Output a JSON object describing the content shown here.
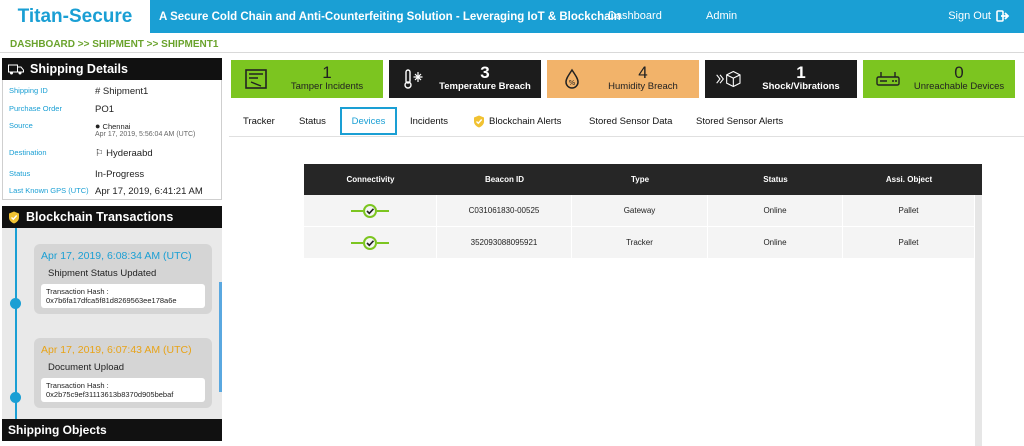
{
  "app": {
    "brand": "Titan-Secure",
    "tagline": "A Secure Cold Chain and Anti-Counterfeiting Solution - Leveraging IoT & Blockchain",
    "nav": [
      "Dashboard",
      "Admin"
    ],
    "signout": "Sign Out"
  },
  "breadcrumb": "DASHBOARD >> SHIPMENT >> SHIPMENT1",
  "shipping": {
    "title": "Shipping Details",
    "fields": [
      {
        "key": "Shipping ID",
        "value": "# Shipment1"
      },
      {
        "key": "Purchase Order",
        "value": "PO1"
      },
      {
        "key": "Source",
        "value": "Chennai",
        "sub": "Apr 17, 2019, 5:56:04 AM (UTC)"
      },
      {
        "key": "Destination",
        "value": "Hyderaabd"
      },
      {
        "key": "Status",
        "value": "In-Progress"
      },
      {
        "key": "Last Known GPS (UTC)",
        "value": "Apr 17, 2019, 6:41:21 AM"
      }
    ]
  },
  "blockchain": {
    "title": "Blockchain Transactions",
    "items": [
      {
        "time": "Apr 17, 2019, 6:08:34 AM (UTC)",
        "event": "Shipment Status Updated",
        "hash_label": "Transaction Hash :",
        "hash": "0x7b6fa17dfca5f81d8269563ee178a6e"
      },
      {
        "time": "Apr 17, 2019, 6:07:43 AM (UTC)",
        "event": "Document Upload",
        "hash_label": "Transaction Hash :",
        "hash": "0x2b75c9ef31113613b8370d905bebaf"
      }
    ],
    "time_colors": [
      "#1a9fd4",
      "#e8a317"
    ]
  },
  "objects": {
    "title": "Shipping Objects"
  },
  "stats": [
    {
      "count": "1",
      "label": "Tamper Incidents",
      "color": "#7cc520",
      "icon": "tamper-icon"
    },
    {
      "count": "3",
      "label": "Temperature Breach",
      "color": "#1c1c1c",
      "icon": "snowflake-thermometer-icon"
    },
    {
      "count": "4",
      "label": "Humidity Breach",
      "color": "#f2b36a",
      "icon": "humidity-drop-icon"
    },
    {
      "count": "1",
      "label": "Shock/Vibrations",
      "color": "#1c1c1c",
      "icon": "shock-box-icon"
    },
    {
      "count": "0",
      "label": "Unreachable Devices",
      "color": "#7cc520",
      "icon": "router-icon"
    }
  ],
  "tabs": [
    {
      "label": "Tracker"
    },
    {
      "label": "Status"
    },
    {
      "label": "Devices"
    },
    {
      "label": "Incidents"
    },
    {
      "label": "Blockchain Alerts"
    },
    {
      "label": "Stored Sensor Data"
    },
    {
      "label": "Stored Sensor Alerts"
    }
  ],
  "active_tab": "Devices",
  "devices": {
    "columns": [
      "Connectivity",
      "Beacon ID",
      "Type",
      "Status",
      "Assi. Object"
    ],
    "rows": [
      {
        "beacon": "C031061830-00525",
        "type": "Gateway",
        "status": "Online",
        "object": "Pallet"
      },
      {
        "beacon": "352093088095921",
        "type": "Tracker",
        "status": "Online",
        "object": "Pallet"
      }
    ]
  }
}
